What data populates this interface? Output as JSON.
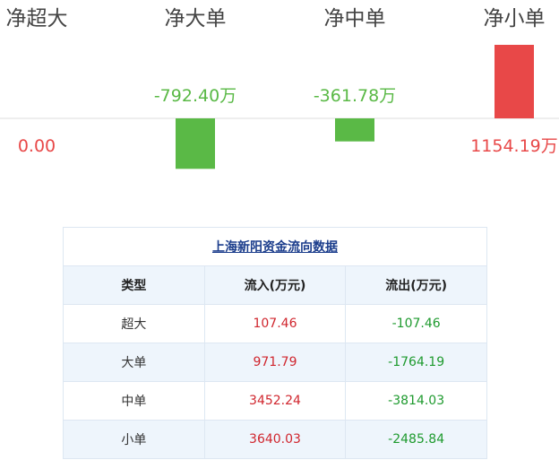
{
  "colors": {
    "positive": "#e84848",
    "negative": "#5ab946",
    "positive_text": "#e84848",
    "negative_text": "#5ab946",
    "axis": "#dddddd"
  },
  "chart_data": {
    "type": "bar",
    "categories": [
      "净超大",
      "净大单",
      "净中单",
      "净小单"
    ],
    "values": [
      0.0,
      -792.4,
      -361.78,
      1154.19
    ],
    "value_labels": [
      "0.00",
      "-792.40万",
      "-361.78万",
      "1154.19万"
    ],
    "unit": "万",
    "ylim": [
      -1154.19,
      1154.19
    ]
  },
  "table": {
    "title": "上海新阳资金流向数据",
    "headers": [
      "类型",
      "流入(万元)",
      "流出(万元)"
    ],
    "rows": [
      {
        "type": "超大",
        "inflow": "107.46",
        "outflow": "-107.46"
      },
      {
        "type": "大单",
        "inflow": "971.79",
        "outflow": "-1764.19"
      },
      {
        "type": "中单",
        "inflow": "3452.24",
        "outflow": "-3814.03"
      },
      {
        "type": "小单",
        "inflow": "3640.03",
        "outflow": "-2485.84"
      }
    ]
  }
}
